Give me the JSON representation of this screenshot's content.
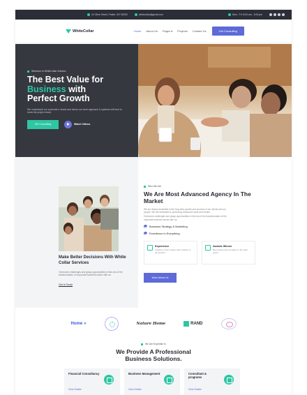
{
  "topbar": {
    "address": "24 Olive Street, Prairie, WY 82000",
    "email": "whitecollar@gmail.com",
    "hours": "Mon - Fri: 8:00 am - 5:00 pm"
  },
  "nav": {
    "logo": "WhiteCollar",
    "links": [
      "Home",
      "About Us",
      "Pages ▾",
      "Projects",
      "Contact Us"
    ],
    "cta": "Get Consulting"
  },
  "hero": {
    "tag": "Welcome to WhiteCollar Solution",
    "title_line1": "The Best Value for",
    "title_accent": "Business",
    "title_line2": " with",
    "title_line3": "Perfect Growth",
    "description": "We understand our customer's needs and hence our work approach & systems will tend to know the project result.",
    "btn_consult": "Get Consulting",
    "btn_video": "Watch Videos"
  },
  "about": {
    "card_title": "Make Better Decisions With White Collar Services",
    "card_desc": "Overcome challenges and grasp opportunities in this era of the transformation of corporate business sector with us.",
    "card_link": "Get In Touch",
    "tag": "Who We Are",
    "title": "We Are Most Advanced Agency In The Market",
    "text1": "We are deeply dedicated to the long term growth and success of our clients and our people. We are dedicated to producing measured value and results.",
    "text2": "Overcome challenges and grasp opportunities in this era of the transformation of the corporate business sector with us.",
    "checks": [
      "Business Strategy & Marketing",
      "Excellence in Everything"
    ],
    "feature1_title": "Experience",
    "feature1_desc": "Leaders in the market with creative & successful.",
    "feature2_title": "Awards Winner",
    "feature2_desc": "Best performed company in the past years.",
    "more_btn": "More About Us"
  },
  "brands": {
    "home": "Home",
    "home_accent": "»",
    "nature": "Nature Home",
    "rand": "RAND"
  },
  "expertise": {
    "tag": "We Are Expertise In",
    "title_line1": "We Provide A Professional",
    "title_line2": "Business Solutions.",
    "services": [
      {
        "title": "Financial Consultancy",
        "link": "View Details"
      },
      {
        "title": "Business Management",
        "link": "View Details"
      },
      {
        "title": "Consultant & programs",
        "link": "View Details"
      }
    ]
  },
  "colors": {
    "accent_green": "#2ec6a3",
    "accent_purple": "#5d6ad8",
    "dark": "#35383f"
  }
}
